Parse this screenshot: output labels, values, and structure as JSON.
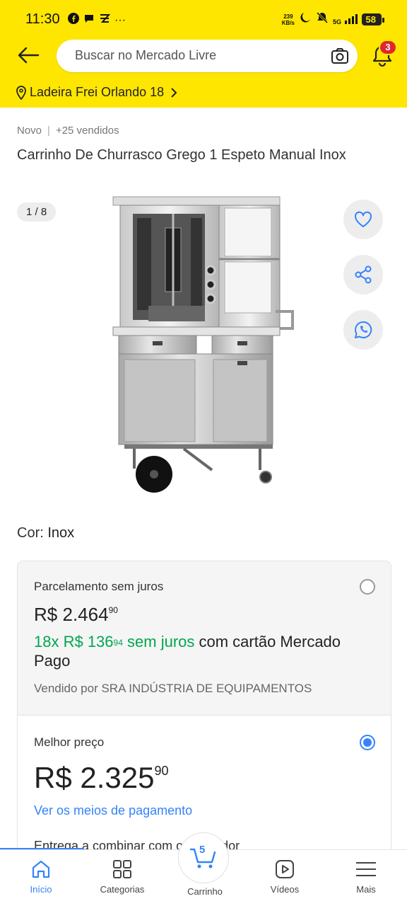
{
  "status_bar": {
    "time": "11:30",
    "ellipsis": "···",
    "net_speed_value": "239",
    "net_speed_unit": "KB/s",
    "network": "5G",
    "battery": "58"
  },
  "header": {
    "search_placeholder": "Buscar no Mercado Livre",
    "notification_count": "3",
    "location": "Ladeira Frei Orlando 18"
  },
  "product": {
    "condition": "Novo",
    "separator": "|",
    "sold": "+25 vendidos",
    "title": "Carrinho De Churrasco Grego 1 Espeto Manual Inox",
    "image_counter": "1 / 8",
    "color_label": "Cor:",
    "color_value": "Inox"
  },
  "purchase_options": {
    "option1": {
      "title": "Parcelamento sem juros",
      "price_currency": "R$",
      "price_int": "2.464",
      "price_cents": "90",
      "installments_prefix": "18x R$ 136",
      "installments_cents": "94",
      "installments_suffix": "sem juros",
      "installments_rest": "com cartão Mercado Pago",
      "seller": "Vendido por SRA INDÚSTRIA DE EQUIPAMENTOS",
      "selected": false
    },
    "option2": {
      "title": "Melhor preço",
      "price_currency": "R$",
      "price_int": "2.325",
      "price_cents": "90",
      "payment_link": "Ver os meios de pagamento",
      "delivery": "Entrega a combinar com o vendedor",
      "selected": true
    }
  },
  "bottom_nav": {
    "items": [
      {
        "label": "Início",
        "icon": "home-icon",
        "active": true
      },
      {
        "label": "Categorias",
        "icon": "grid-icon",
        "active": false
      },
      {
        "label": "Carrinho",
        "icon": "cart-icon",
        "active": false
      },
      {
        "label": "Vídeos",
        "icon": "video-icon",
        "active": false
      },
      {
        "label": "Mais",
        "icon": "menu-icon",
        "active": false
      }
    ],
    "cart_count": "5"
  },
  "colors": {
    "brand_yellow": "#FFE600",
    "accent_blue": "#3483FA",
    "green": "#00A650",
    "badge_red": "#E0262F"
  }
}
